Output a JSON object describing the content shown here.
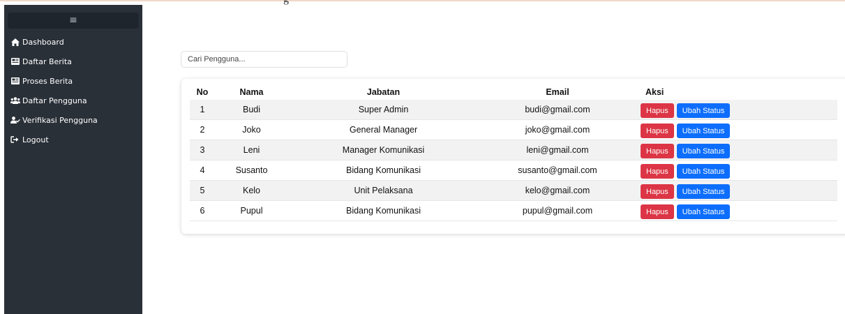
{
  "sidebar": {
    "toggle_label": "≡",
    "items": [
      {
        "label": "Dashboard",
        "icon": "home-icon"
      },
      {
        "label": "Daftar Berita",
        "icon": "newspaper-icon"
      },
      {
        "label": "Proses Berita",
        "icon": "newspaper-icon"
      },
      {
        "label": "Daftar Pengguna",
        "icon": "users-icon"
      },
      {
        "label": "Verifikasi Pengguna",
        "icon": "user-check-icon"
      },
      {
        "label": "Logout",
        "icon": "logout-icon"
      }
    ]
  },
  "search": {
    "placeholder": "Cari Pengguna..."
  },
  "table": {
    "headers": {
      "no": "No",
      "nama": "Nama",
      "jabatan": "Jabatan",
      "email": "Email",
      "aksi": "Aksi"
    },
    "rows": [
      {
        "no": "1",
        "nama": "Budi",
        "jabatan": "Super Admin",
        "email": "budi@gmail.com"
      },
      {
        "no": "2",
        "nama": "Joko",
        "jabatan": "General Manager",
        "email": "joko@gmail.com"
      },
      {
        "no": "3",
        "nama": "Leni",
        "jabatan": "Manager Komunikasi",
        "email": "leni@gmail.com"
      },
      {
        "no": "4",
        "nama": "Susanto",
        "jabatan": "Bidang Komunikasi",
        "email": "susanto@gmail.com"
      },
      {
        "no": "5",
        "nama": "Kelo",
        "jabatan": "Unit Pelaksana",
        "email": "kelo@gmail.com"
      },
      {
        "no": "6",
        "nama": "Pupul",
        "jabatan": "Bidang Komunikasi",
        "email": "pupul@gmail.com"
      }
    ],
    "delete_label": "Hapus",
    "status_label": "Ubah Status"
  },
  "colors": {
    "sidebar_bg": "#2a3038",
    "delete": "#dc3545",
    "status": "#0d6efd",
    "stripe": "#f2f2f2"
  }
}
